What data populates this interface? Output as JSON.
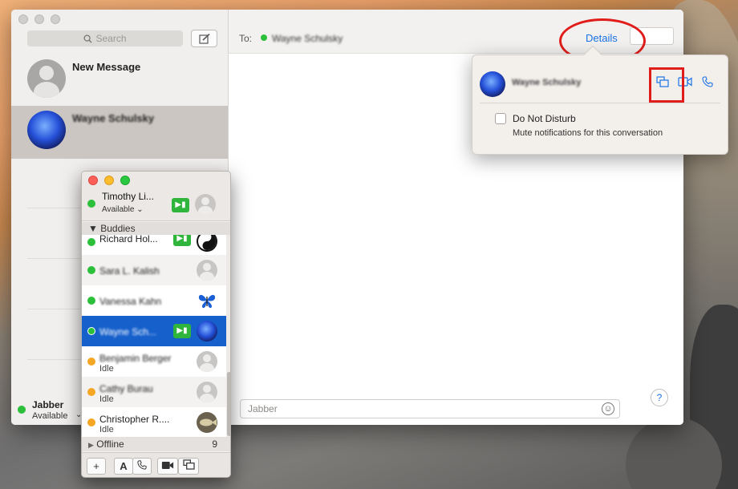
{
  "messages": {
    "search_placeholder": "Search",
    "conversations": [
      {
        "name": "New Message"
      },
      {
        "name": "Wayne Schulsky"
      }
    ],
    "account": {
      "name": "Jabber",
      "status": "Available"
    },
    "to_label": "To:",
    "recipient": "Wayne Schulsky",
    "details_label": "Details",
    "input_placeholder": "Jabber",
    "help_label": "?"
  },
  "details_popover": {
    "contact_name": "Wayne Schulsky",
    "icons": [
      "screen-share-icon",
      "video-camera-icon",
      "phone-icon"
    ],
    "dnd_label": "Do Not Disturb",
    "dnd_checked": false,
    "dnd_sub": "Mute notifications for this conversation"
  },
  "buddy_list": {
    "me": {
      "name": "Timothy Li...",
      "status": "Available"
    },
    "group_label": "Buddies",
    "buddies": [
      {
        "name": "Richard Hol...",
        "status": "",
        "presence": "available"
      },
      {
        "name": "Sara L. Kalish",
        "status": "",
        "presence": "available"
      },
      {
        "name": "Vanessa Kahn",
        "status": "",
        "presence": "available"
      },
      {
        "name": "Wayne Sch...",
        "status": "",
        "presence": "available",
        "selected": true
      },
      {
        "name": "Benjamin Berger",
        "status": "Idle",
        "presence": "idle"
      },
      {
        "name": "Cathy Burau",
        "status": "Idle",
        "presence": "idle"
      },
      {
        "name": "Christopher R....",
        "status": "Idle",
        "presence": "idle"
      }
    ],
    "offline_label": "Offline",
    "offline_count": "9",
    "toolbar": {
      "add": "+",
      "font": "A"
    }
  },
  "colors": {
    "accent_blue": "#1b72e6",
    "available_green": "#2bbf3a",
    "idle_orange": "#f5a623",
    "annotation_red": "#e01d1a",
    "selection_blue": "#1660cc"
  }
}
